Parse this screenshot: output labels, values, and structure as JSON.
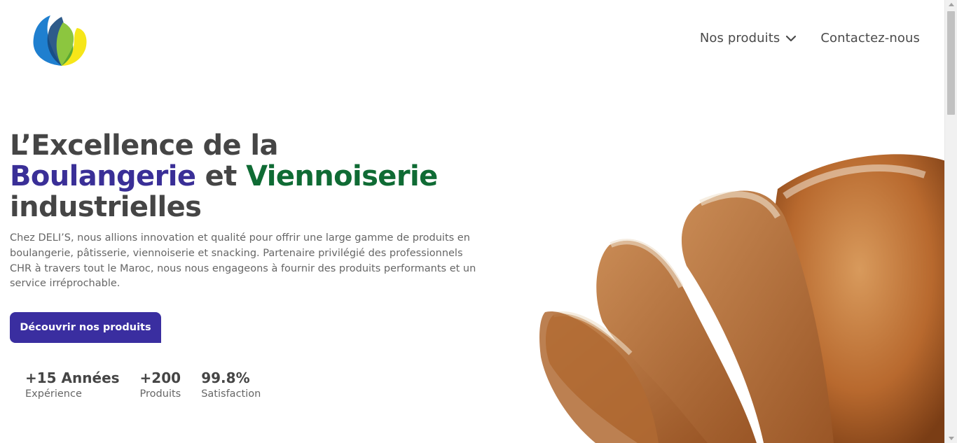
{
  "header": {
    "logo_icon": "leaf-petals-logo-icon",
    "nav": {
      "products_label": "Nos produits",
      "contact_label": "Contactez-nous"
    }
  },
  "hero": {
    "title_line1": "L’Excellence de la",
    "title_word_blue": "Boulangerie",
    "title_word_and": " et ",
    "title_word_green": "Viennoiserie",
    "title_line3": "industrielles",
    "description": "Chez DELI’S, nous allions innovation et qualité pour offrir une large gamme de produits en boulangerie, pâtisserie, viennoiserie et snacking. Partenaire privilégié des professionnels CHR à travers tout le Maroc, nous nous engageons à fournir des produits performants et un service irréprochable.",
    "cta_label": "Découvrir nos produits"
  },
  "stats": [
    {
      "value": "+15 Années",
      "label": "Expérience"
    },
    {
      "value": "+200",
      "label": "Produits"
    },
    {
      "value": "99.8%",
      "label": "Satisfaction"
    }
  ],
  "colors": {
    "primary": "#3a2ea0",
    "accent_blue": "#3a2f97",
    "accent_green": "#0f6b34",
    "text": "#454545"
  }
}
